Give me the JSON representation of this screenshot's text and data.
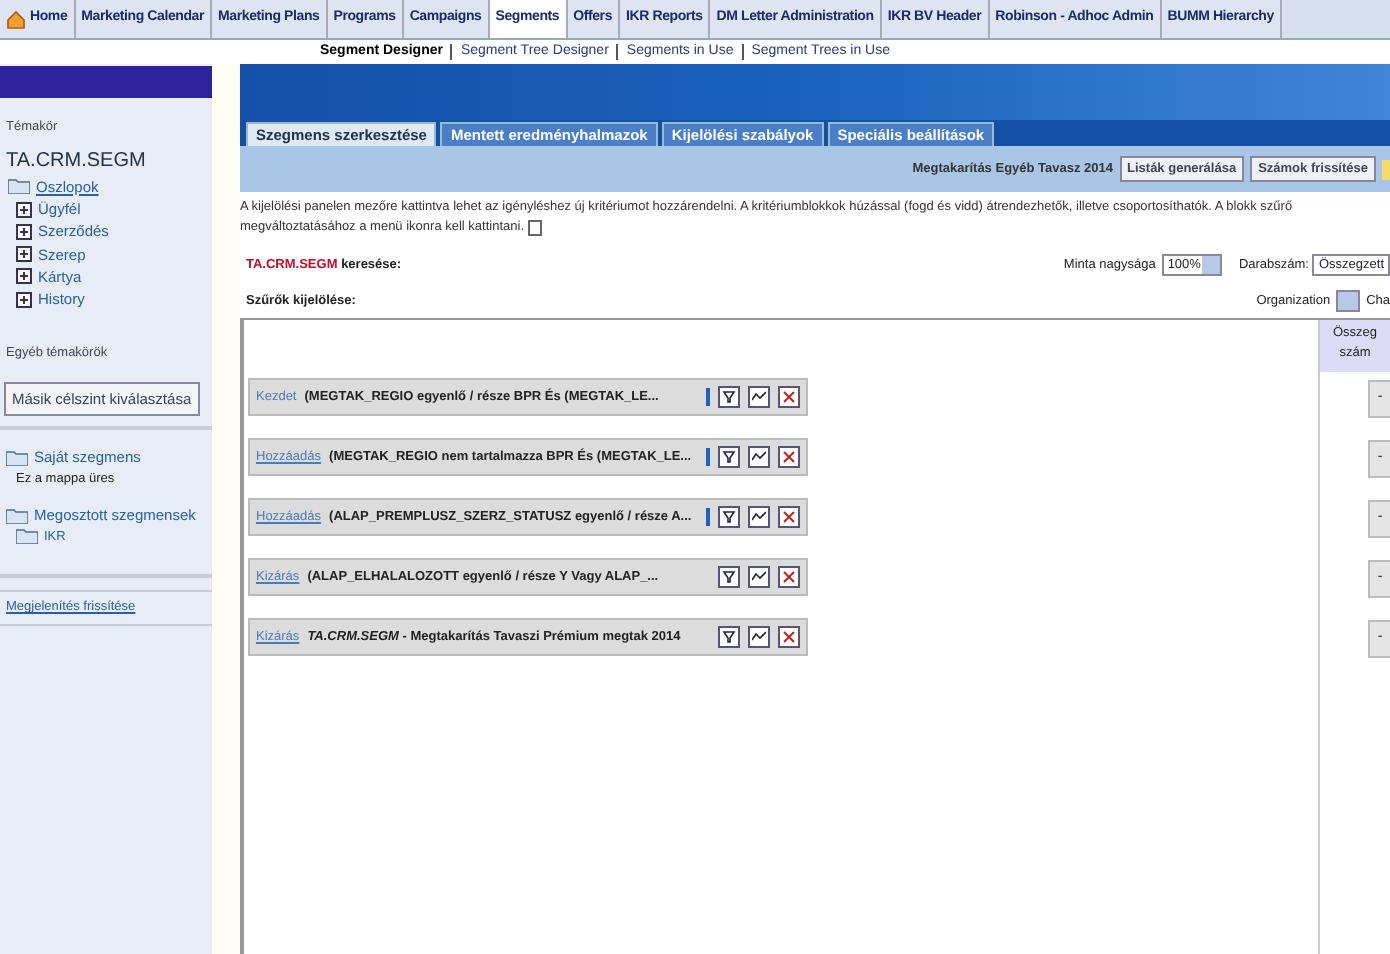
{
  "nav_tabs": [
    {
      "label": "Home",
      "selected": false,
      "kind": "home"
    },
    {
      "label": "Marketing Calendar",
      "selected": false
    },
    {
      "label": "Marketing Plans",
      "selected": false
    },
    {
      "label": "Programs",
      "selected": false
    },
    {
      "label": "Campaigns",
      "selected": false
    },
    {
      "label": "Segments",
      "selected": true
    },
    {
      "label": "Offers",
      "selected": false
    },
    {
      "label": "IKR Reports",
      "selected": false
    },
    {
      "label": "DM Letter Administration",
      "selected": false
    },
    {
      "label": "IKR BV Header",
      "selected": false
    },
    {
      "label": "Robinson - Adhoc Admin",
      "selected": false
    },
    {
      "label": "BUMM Hierarchy",
      "selected": false
    }
  ],
  "sub_nav": [
    {
      "label": "Segment Designer",
      "selected": true
    },
    {
      "label": "Segment Tree Designer",
      "selected": false
    },
    {
      "label": "Segments in Use",
      "selected": false
    },
    {
      "label": "Segment Trees in Use",
      "selected": false
    }
  ],
  "sidebar": {
    "section_label": "Témakör",
    "subject": "TA.CRM.SEGM",
    "tree": [
      {
        "label": "Oszlopok",
        "children": [
          {
            "label": "Ügyfél"
          },
          {
            "label": "Szerződés"
          },
          {
            "label": "Szerep"
          },
          {
            "label": "Kártya"
          },
          {
            "label": "History"
          }
        ]
      }
    ],
    "other_label": "Egyéb témakörök",
    "select_button": "Másik célszint kiválasztása",
    "folders": [
      {
        "label": "Saját szegmens",
        "note": "Ez a mappa üres"
      },
      {
        "label": "Megosztott szegmensek",
        "children": [
          {
            "label": "IKR"
          }
        ]
      }
    ],
    "refresh_link": "Megjelenítés frissítése"
  },
  "tabs": [
    {
      "label": "Szegmens szerkesztése",
      "selected": true
    },
    {
      "label": "Mentett eredményhalmazok",
      "selected": false
    },
    {
      "label": "Kijelölési szabályok",
      "selected": false
    },
    {
      "label": "Speciális beállítások",
      "selected": false
    }
  ],
  "toolbar": {
    "segment_name": "Megtakarítás Egyéb Tavasz 2014",
    "buttons": [
      "Listák generálása",
      "Számok frissítése"
    ]
  },
  "intro": "A kijelölési panelen mezőre kattintva lehet az igényléshez új kritériumot hozzárendelni. A kritériumblokkok húzással (fogd és vidd) átrendezhetők, illetve csoportosíthatók. A blokk szűrő",
  "intro_line2": "megváltoztatásához a menü ikonra kell kattintani.",
  "search": {
    "subject": "TA.CRM.SEGM",
    "label": "keresése:",
    "sample_label": "Minta nagysága",
    "sample_value": "100%",
    "count_label": "Darabszám:",
    "count_value": "Összegzett"
  },
  "filters": {
    "label": "Szűrők kijelölése:",
    "org_label": "Organization",
    "cut_label": "Cha"
  },
  "count_column": {
    "heading": "Összeg",
    "heading2": "szám"
  },
  "blocks": [
    {
      "action": "Kezdet",
      "underlined": false,
      "text": "(MEGTAK_REGIO egyenlő / része BPR És (MEGTAK_LE...",
      "marker": true,
      "count": "-"
    },
    {
      "action": "Hozzáadás",
      "underlined": true,
      "text": "(MEGTAK_REGIO nem tartalmazza BPR És (MEGTAK_LE...",
      "marker": true,
      "count": "-"
    },
    {
      "action": "Hozzáadás",
      "underlined": true,
      "text": "(ALAP_PREMPLUSZ_SZERZ_STATUSZ egyenlő / része A...",
      "marker": true,
      "count": "-"
    },
    {
      "action": "Kizárás",
      "underlined": true,
      "text": "(ALAP_ELHALALOZOTT egyenlő / része Y Vagy ALAP_...",
      "marker": false,
      "count": "-"
    },
    {
      "action": "Kizárás",
      "underlined": true,
      "text": "*TA.CRM.SEGM* - Megtakarítás Tavaszi Prémium megtak 2014",
      "marker": false,
      "count": "-"
    }
  ]
}
